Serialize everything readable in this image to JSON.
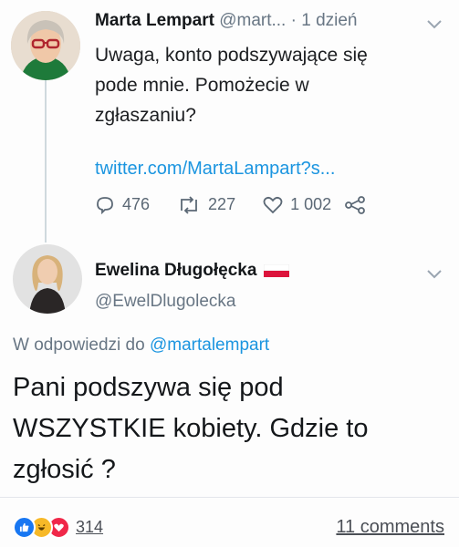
{
  "tweet1": {
    "display_name": "Marta Lempart",
    "handle": "@mart...",
    "separator": "·",
    "time": "1 dzień",
    "lines": [
      "Uwaga, konto podszywające się",
      "pode mnie. Pomożecie w",
      "zgłaszaniu?"
    ],
    "link": "twitter.com/MartaLampart?s...",
    "replies": "476",
    "retweets": "227",
    "likes": "1 002"
  },
  "tweet2": {
    "display_name": "Ewelina Długołęcka",
    "flag": "Poland flag",
    "handle": "@EwelDlugolecka",
    "reply_prefix": "W odpowiedzi do",
    "reply_to": "@martalempart",
    "lines": [
      "Pani podszywa się pod",
      "WSZYSTKIE kobiety. Gdzie to",
      "zgłosić ?"
    ]
  },
  "footer": {
    "reaction_count": "314",
    "comments": "11 comments",
    "reaction_icons": [
      "like-icon",
      "haha-icon",
      "love-icon"
    ]
  },
  "colors": {
    "link": "#1b95e0",
    "muted": "#687684",
    "like": "#1877f2",
    "haha": "#f7b928",
    "love": "#f02849"
  }
}
